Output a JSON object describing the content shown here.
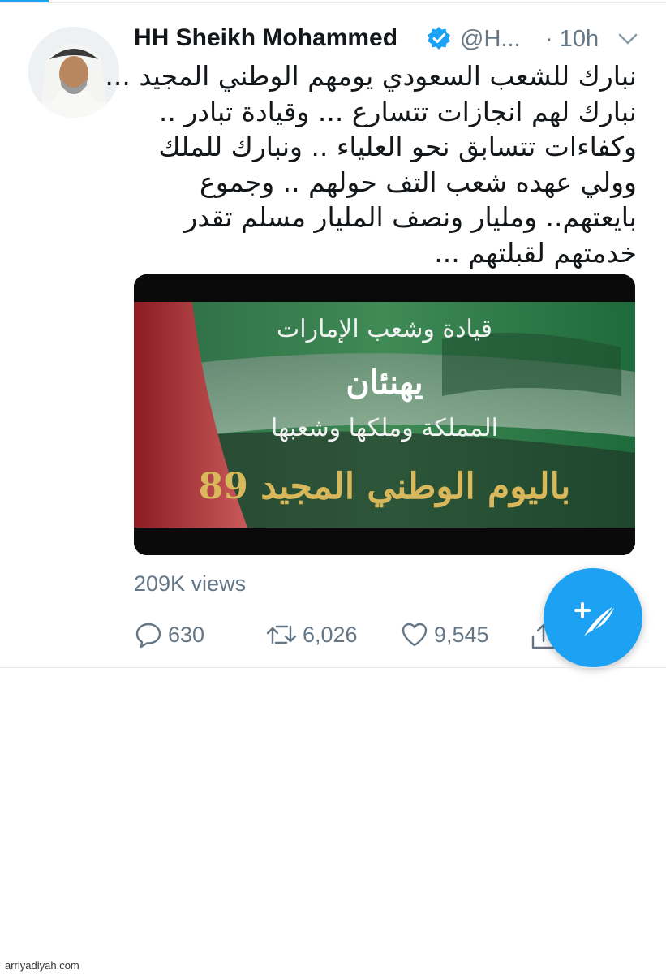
{
  "tweet": {
    "display_name": "HH Sheikh Mohammed",
    "handle": "@H...",
    "time": "· 10h",
    "text_lines": [
      "نبارك للشعب السعودي يومهم الوطني المجيد ...",
      "نبارك لهم انجازات تتسارع ... وقيادة تبادر ..",
      "وكفاءات تتسابق نحو العلياء .. ونبارك للملك",
      "وولي عهده شعب التف حولهم .. وجموع",
      "بايعتهم.. ومليار ونصف المليار مسلم تقدر",
      "خدمتهم لقبلتهم ..."
    ],
    "media": {
      "lines": [
        "قيادة وشعب الإمارات",
        "يهنئان",
        "المملكة وملكها وشعبها",
        "باليوم الوطني المجيد 89"
      ]
    },
    "views": "209K views",
    "actions": {
      "reply_count": "630",
      "retweet_count": "6,026",
      "like_count": "9,545"
    }
  },
  "icons": {
    "verified": "verified-badge-icon",
    "more": "chevron-down-icon",
    "reply": "reply-icon",
    "retweet": "retweet-icon",
    "like": "heart-icon",
    "share": "share-icon",
    "compose": "compose-tweet-icon"
  },
  "colors": {
    "accent": "#1da1f2",
    "secondary_text": "#657786",
    "media_gold": "#d8b85a"
  },
  "watermark": "arriyadiyah.com"
}
